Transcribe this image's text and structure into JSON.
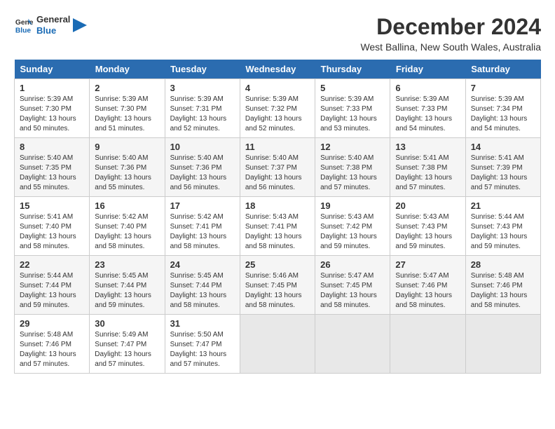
{
  "logo": {
    "text_general": "General",
    "text_blue": "Blue"
  },
  "title": "December 2024",
  "subtitle": "West Ballina, New South Wales, Australia",
  "weekdays": [
    "Sunday",
    "Monday",
    "Tuesday",
    "Wednesday",
    "Thursday",
    "Friday",
    "Saturday"
  ],
  "weeks": [
    [
      {
        "day": "1",
        "sunrise": "5:39 AM",
        "sunset": "7:30 PM",
        "daylight": "13 hours and 50 minutes."
      },
      {
        "day": "2",
        "sunrise": "5:39 AM",
        "sunset": "7:30 PM",
        "daylight": "13 hours and 51 minutes."
      },
      {
        "day": "3",
        "sunrise": "5:39 AM",
        "sunset": "7:31 PM",
        "daylight": "13 hours and 52 minutes."
      },
      {
        "day": "4",
        "sunrise": "5:39 AM",
        "sunset": "7:32 PM",
        "daylight": "13 hours and 52 minutes."
      },
      {
        "day": "5",
        "sunrise": "5:39 AM",
        "sunset": "7:33 PM",
        "daylight": "13 hours and 53 minutes."
      },
      {
        "day": "6",
        "sunrise": "5:39 AM",
        "sunset": "7:33 PM",
        "daylight": "13 hours and 54 minutes."
      },
      {
        "day": "7",
        "sunrise": "5:39 AM",
        "sunset": "7:34 PM",
        "daylight": "13 hours and 54 minutes."
      }
    ],
    [
      {
        "day": "8",
        "sunrise": "5:40 AM",
        "sunset": "7:35 PM",
        "daylight": "13 hours and 55 minutes."
      },
      {
        "day": "9",
        "sunrise": "5:40 AM",
        "sunset": "7:36 PM",
        "daylight": "13 hours and 55 minutes."
      },
      {
        "day": "10",
        "sunrise": "5:40 AM",
        "sunset": "7:36 PM",
        "daylight": "13 hours and 56 minutes."
      },
      {
        "day": "11",
        "sunrise": "5:40 AM",
        "sunset": "7:37 PM",
        "daylight": "13 hours and 56 minutes."
      },
      {
        "day": "12",
        "sunrise": "5:40 AM",
        "sunset": "7:38 PM",
        "daylight": "13 hours and 57 minutes."
      },
      {
        "day": "13",
        "sunrise": "5:41 AM",
        "sunset": "7:38 PM",
        "daylight": "13 hours and 57 minutes."
      },
      {
        "day": "14",
        "sunrise": "5:41 AM",
        "sunset": "7:39 PM",
        "daylight": "13 hours and 57 minutes."
      }
    ],
    [
      {
        "day": "15",
        "sunrise": "5:41 AM",
        "sunset": "7:40 PM",
        "daylight": "13 hours and 58 minutes."
      },
      {
        "day": "16",
        "sunrise": "5:42 AM",
        "sunset": "7:40 PM",
        "daylight": "13 hours and 58 minutes."
      },
      {
        "day": "17",
        "sunrise": "5:42 AM",
        "sunset": "7:41 PM",
        "daylight": "13 hours and 58 minutes."
      },
      {
        "day": "18",
        "sunrise": "5:43 AM",
        "sunset": "7:41 PM",
        "daylight": "13 hours and 58 minutes."
      },
      {
        "day": "19",
        "sunrise": "5:43 AM",
        "sunset": "7:42 PM",
        "daylight": "13 hours and 59 minutes."
      },
      {
        "day": "20",
        "sunrise": "5:43 AM",
        "sunset": "7:43 PM",
        "daylight": "13 hours and 59 minutes."
      },
      {
        "day": "21",
        "sunrise": "5:44 AM",
        "sunset": "7:43 PM",
        "daylight": "13 hours and 59 minutes."
      }
    ],
    [
      {
        "day": "22",
        "sunrise": "5:44 AM",
        "sunset": "7:44 PM",
        "daylight": "13 hours and 59 minutes."
      },
      {
        "day": "23",
        "sunrise": "5:45 AM",
        "sunset": "7:44 PM",
        "daylight": "13 hours and 59 minutes."
      },
      {
        "day": "24",
        "sunrise": "5:45 AM",
        "sunset": "7:44 PM",
        "daylight": "13 hours and 58 minutes."
      },
      {
        "day": "25",
        "sunrise": "5:46 AM",
        "sunset": "7:45 PM",
        "daylight": "13 hours and 58 minutes."
      },
      {
        "day": "26",
        "sunrise": "5:47 AM",
        "sunset": "7:45 PM",
        "daylight": "13 hours and 58 minutes."
      },
      {
        "day": "27",
        "sunrise": "5:47 AM",
        "sunset": "7:46 PM",
        "daylight": "13 hours and 58 minutes."
      },
      {
        "day": "28",
        "sunrise": "5:48 AM",
        "sunset": "7:46 PM",
        "daylight": "13 hours and 58 minutes."
      }
    ],
    [
      {
        "day": "29",
        "sunrise": "5:48 AM",
        "sunset": "7:46 PM",
        "daylight": "13 hours and 57 minutes."
      },
      {
        "day": "30",
        "sunrise": "5:49 AM",
        "sunset": "7:47 PM",
        "daylight": "13 hours and 57 minutes."
      },
      {
        "day": "31",
        "sunrise": "5:50 AM",
        "sunset": "7:47 PM",
        "daylight": "13 hours and 57 minutes."
      },
      null,
      null,
      null,
      null
    ]
  ],
  "labels": {
    "sunrise": "Sunrise:",
    "sunset": "Sunset:",
    "daylight": "Daylight:"
  }
}
